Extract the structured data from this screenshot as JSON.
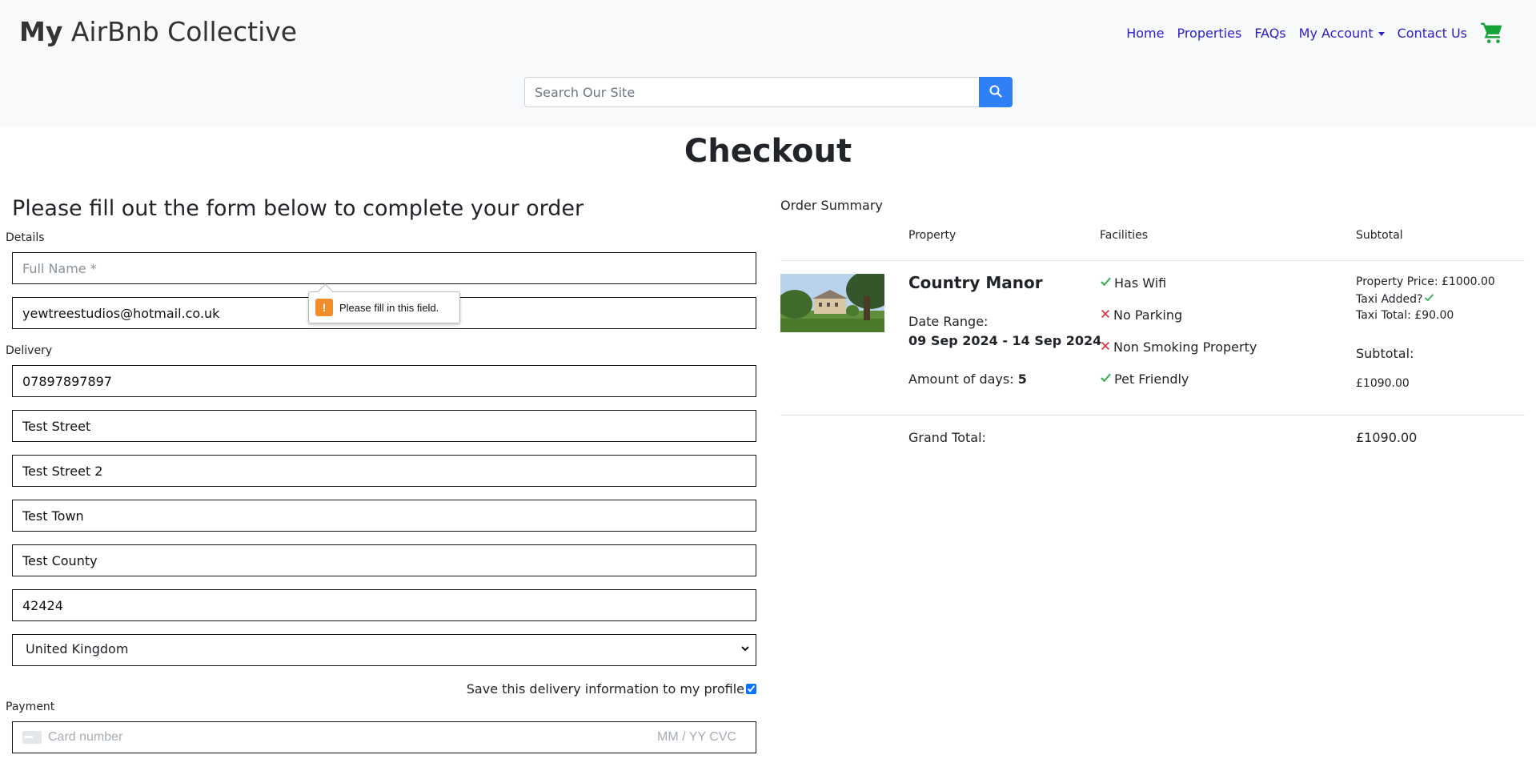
{
  "brand": {
    "bold": "My",
    "rest": " AirBnb Collective"
  },
  "nav": {
    "home": "Home",
    "properties": "Properties",
    "faqs": "FAQs",
    "account": "My Account",
    "contact": "Contact Us"
  },
  "search": {
    "placeholder": "Search Our Site"
  },
  "page_title": "Checkout",
  "form": {
    "heading": "Please fill out the form below to complete your order",
    "details_label": "Details",
    "full_name_placeholder": "Full Name *",
    "email_value": "yewtreestudios@hotmail.co.uk",
    "validation_message": "Please fill in this field.",
    "delivery_label": "Delivery",
    "phone_value": "07897897897",
    "street1_value": "Test Street",
    "street2_value": "Test Street 2",
    "town_value": "Test Town",
    "county_value": "Test County",
    "postcode_value": "42424",
    "country_value": "United Kingdom",
    "save_info_label": "Save this delivery information to my profile",
    "payment_label": "Payment",
    "card_placeholder": "Card number",
    "card_expiry_cvc": "MM / YY  CVC"
  },
  "order_summary": {
    "title": "Order Summary",
    "headers": {
      "property": "Property",
      "facilities": "Facilities",
      "subtotal": "Subtotal"
    },
    "item": {
      "name": "Country Manor",
      "date_range_label": "Date Range:",
      "date_range": "09 Sep 2024 - 14 Sep 2024",
      "days_label": "Amount of days: ",
      "days": "5",
      "facilities": [
        {
          "label": "Has Wifi",
          "available": true
        },
        {
          "label": "No Parking",
          "available": false
        },
        {
          "label": "Non Smoking Property",
          "available": false
        },
        {
          "label": "Pet Friendly",
          "available": true
        }
      ],
      "property_price": "Property Price: £1000.00",
      "taxi_added": "Taxi Added?",
      "taxi_total": "Taxi Total: £90.00",
      "subtotal_label": "Subtotal:",
      "subtotal_value": "£1090.00"
    },
    "grand_total_label": "Grand Total:",
    "grand_total_value": "£1090.00"
  },
  "colors": {
    "link": "#2a1ecf",
    "search_button": "#2f7ff6",
    "cart": "#18a33a",
    "check": "#28a745",
    "cross": "#dc3545"
  }
}
